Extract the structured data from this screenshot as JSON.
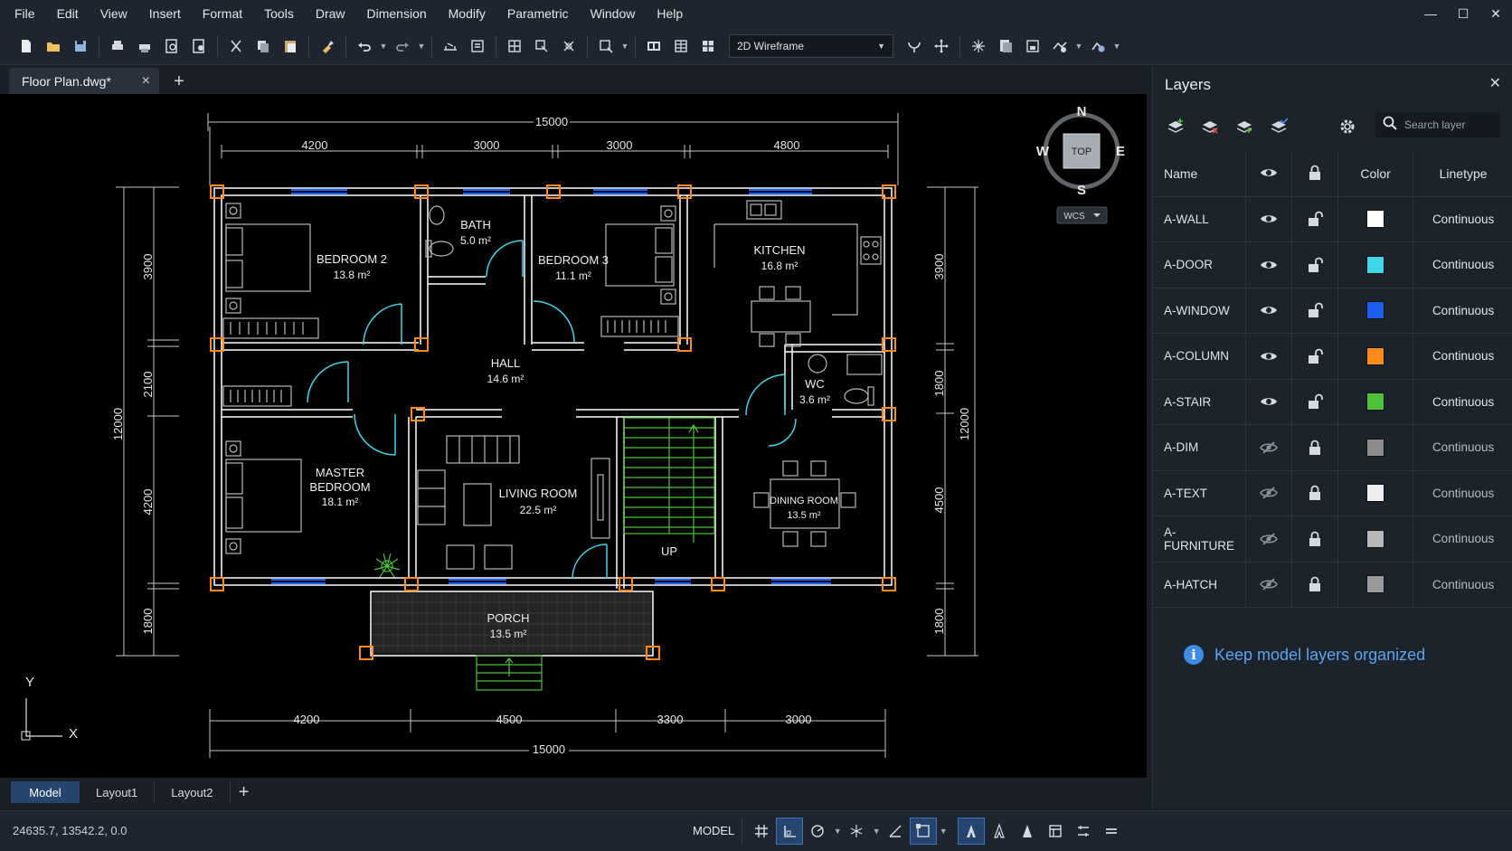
{
  "menu": [
    "File",
    "Edit",
    "View",
    "Insert",
    "Format",
    "Tools",
    "Draw",
    "Dimension",
    "Modify",
    "Parametric",
    "Window",
    "Help"
  ],
  "window_controls": {
    "minimize": "—",
    "maximize": "☐",
    "close": "✕"
  },
  "toolbar": {
    "visual_style": "2D Wireframe",
    "icons": [
      "new-icon",
      "open-icon",
      "save-icon",
      "print-icon",
      "plot-icon",
      "preview-icon",
      "publish-icon",
      "cut-icon",
      "copy-icon",
      "paste-icon",
      "match-properties-icon",
      "undo-icon",
      "redo-icon",
      "measure-icon",
      "properties-icon",
      "block-icon",
      "insert-icon",
      "attach-icon",
      "zoom-icon",
      "layout-icon",
      "table-icon",
      "hatch-icon",
      "orbit-icon",
      "pan-icon",
      "snap-icon",
      "sheet-icon",
      "render-icon",
      "visibility-icon",
      "settings-icon"
    ]
  },
  "document": {
    "tab_title": "Floor Plan.dwg*",
    "close": "×",
    "add": "+"
  },
  "viewcube": {
    "n": "N",
    "s": "S",
    "e": "E",
    "w": "W",
    "face": "TOP",
    "ucs": "WCS"
  },
  "ucs_icon": {
    "x": "X",
    "y": "Y"
  },
  "plan": {
    "rooms": [
      {
        "name": "BEDROOM 2",
        "area": "13.8 m²"
      },
      {
        "name": "BATH",
        "area": "5.0 m²"
      },
      {
        "name": "BEDROOM 3",
        "area": "11.1 m²"
      },
      {
        "name": "KITCHEN",
        "area": "16.8 m²"
      },
      {
        "name": "HALL",
        "area": "14.6 m²"
      },
      {
        "name": "WC",
        "area": "3.6 m²"
      },
      {
        "name": "MASTER",
        "name2": "BEDROOM",
        "area": "18.1 m²"
      },
      {
        "name": "LIVING ROOM",
        "area": "22.5 m²"
      },
      {
        "name": "DINING ROOM",
        "area": "13.5 m²"
      },
      {
        "name": "PORCH",
        "area": "13.5 m²"
      }
    ],
    "stair_label": "UP",
    "dims": {
      "top_total": "15000",
      "top_segments": [
        "4200",
        "3000",
        "3000",
        "4800"
      ],
      "bottom_total": "15000",
      "bottom_segments": [
        "4200",
        "4500",
        "3300",
        "3000"
      ],
      "left_total": "12000",
      "left_segments": [
        "3900",
        "2100",
        "4200",
        "1800"
      ],
      "right_total": "12000",
      "right_segments": [
        "3900",
        "1800",
        "4500",
        "1800"
      ]
    }
  },
  "layout_tabs": [
    "Model",
    "Layout1",
    "Layout2"
  ],
  "layout_add": "+",
  "status": {
    "coords": "24635.7, 13542.2, 0.0",
    "model": "MODEL"
  },
  "layers_panel": {
    "title": "Layers",
    "close": "✕",
    "search_placeholder": "Search layer",
    "columns": {
      "name": "Name",
      "color": "Color",
      "linetype": "Linetype"
    },
    "rows": [
      {
        "name": "A-WALL",
        "visible": true,
        "locked": false,
        "color": "#ffffff",
        "linetype": "Continuous"
      },
      {
        "name": "A-DOOR",
        "visible": true,
        "locked": false,
        "color": "#3fd6ea",
        "linetype": "Continuous"
      },
      {
        "name": "A-WINDOW",
        "visible": true,
        "locked": false,
        "color": "#1f5ff0",
        "linetype": "Continuous"
      },
      {
        "name": "A-COLUMN",
        "visible": true,
        "locked": false,
        "color": "#ff8a1c",
        "linetype": "Continuous"
      },
      {
        "name": "A-STAIR",
        "visible": true,
        "locked": false,
        "color": "#4cc23b",
        "linetype": "Continuous"
      },
      {
        "name": "A-DIM",
        "visible": false,
        "locked": true,
        "color": "#8c8c8c",
        "linetype": "Continuous"
      },
      {
        "name": "A-TEXT",
        "visible": false,
        "locked": true,
        "color": "#eeeeee",
        "linetype": "Continuous"
      },
      {
        "name": "A-FURNITURE",
        "visible": false,
        "locked": true,
        "color": "#b8b8b8",
        "linetype": "Continuous"
      },
      {
        "name": "A-HATCH",
        "visible": false,
        "locked": true,
        "color": "#9a9a9a",
        "linetype": "Continuous"
      }
    ],
    "tip": "Keep model layers organized"
  },
  "colors": {
    "accent": "#3e8ce6",
    "wall": "#ffffff",
    "door": "#3fd6ea",
    "window": "#1f5ff0",
    "column": "#ff8a1c",
    "stair": "#4cc23b"
  }
}
